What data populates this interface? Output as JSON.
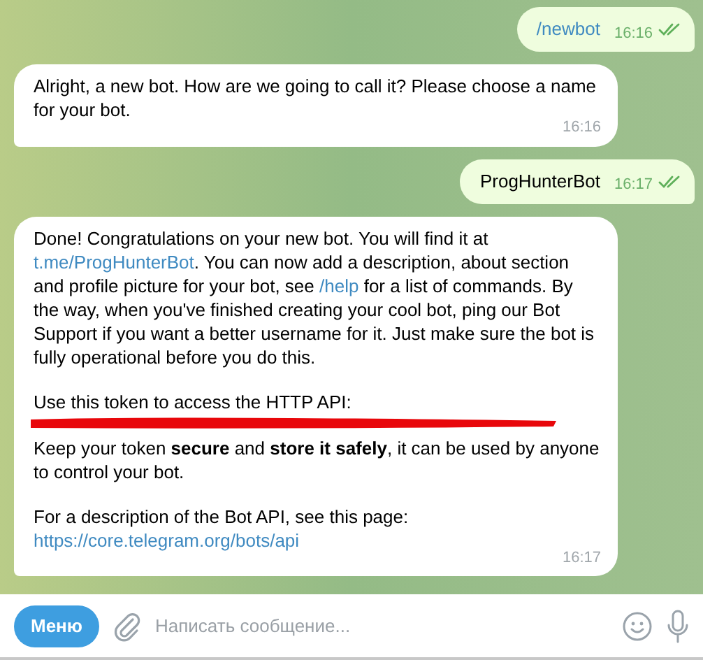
{
  "messages": [
    {
      "kind": "outgoing",
      "text": "/newbot",
      "command": true,
      "time": "16:16",
      "read": true
    },
    {
      "kind": "incoming",
      "paragraphs": [
        {
          "kind": "text",
          "parts": [
            {
              "kind": "text",
              "text": "Alright, a new bot. How are we going to call it? Please choose a name for your bot."
            }
          ]
        }
      ],
      "time": "16:16"
    },
    {
      "kind": "outgoing",
      "text": "ProgHunterBot",
      "command": false,
      "time": "16:17",
      "read": true
    },
    {
      "kind": "incoming",
      "paragraphs": [
        {
          "kind": "text",
          "parts": [
            {
              "kind": "text",
              "text": "Done! Congratulations on your new bot. You will find it at "
            },
            {
              "kind": "link",
              "text": "t.me/ProgHunterBot"
            },
            {
              "kind": "text",
              "text": ". You can now add a description, about section and profile picture for your bot, see "
            },
            {
              "kind": "link",
              "text": "/help"
            },
            {
              "kind": "text",
              "text": " for a list of commands. By the way, when you've finished creating your cool bot, ping our Bot Support if you want a better username for it. Just make sure the bot is fully operational before you do this."
            }
          ]
        },
        {
          "kind": "text",
          "parts": [
            {
              "kind": "text",
              "text": "Use this token to access the HTTP API:"
            }
          ]
        },
        {
          "kind": "redacted"
        },
        {
          "kind": "text",
          "parts": [
            {
              "kind": "text",
              "text": "Keep your token **secure** and **store it safely**, it can be used by anyone to control your bot."
            }
          ]
        },
        {
          "kind": "text",
          "parts": [
            {
              "kind": "text",
              "text": "For a description of the Bot API, see this page:"
            }
          ]
        },
        {
          "kind": "text",
          "parts": [
            {
              "kind": "link",
              "text": "https://core.telegram.org/bots/api"
            }
          ]
        }
      ],
      "time": "16:17"
    }
  ],
  "composer": {
    "menu_button": "Меню",
    "placeholder": "Написать сообщение..."
  }
}
